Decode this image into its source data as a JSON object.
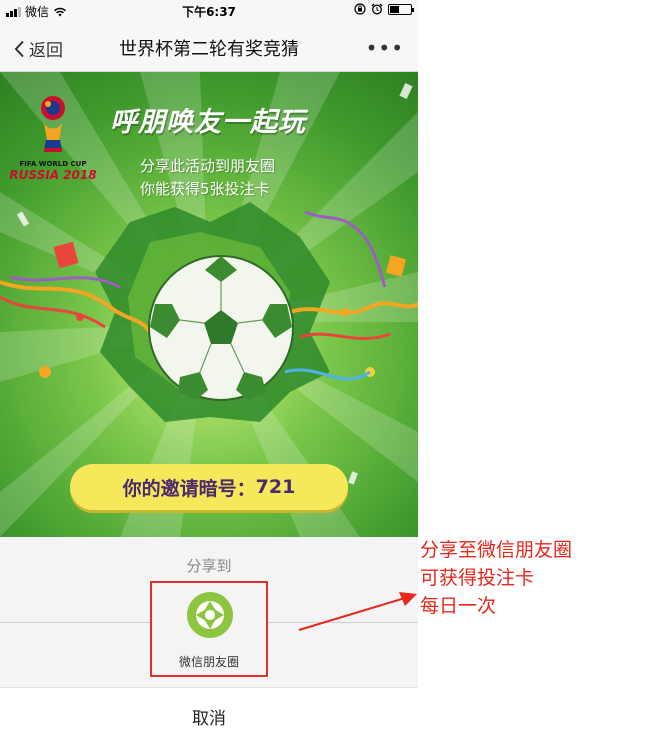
{
  "status_bar": {
    "carrier": "微信",
    "time": "下午6:37",
    "battery_level": 0.45
  },
  "nav": {
    "back_label": "返回",
    "title": "世界杯第二轮有奖竞猜",
    "more_label": "•••"
  },
  "banner": {
    "logo_lines": [
      "FIFA WORLD CUP"
    ],
    "logo_brand": "RUSSIA 2018",
    "headline": "呼朋唤友一起玩",
    "sublines": [
      "分享此活动到朋友圈",
      "你能获得5张投注卡"
    ],
    "invite_label": "你的邀请暗号：",
    "invite_code": "721"
  },
  "share_sheet": {
    "share_to_label": "分享到",
    "moments_label": "微信朋友圈",
    "cancel_label": "取消"
  },
  "annotation": {
    "lines": [
      "分享至微信朋友圈",
      "可获得投注卡",
      "每日一次"
    ],
    "color": "#e8261b"
  },
  "colors": {
    "accent_green": "#8cc63f",
    "highlight_red": "#e0302f",
    "pill_yellow": "#f5e85a",
    "invite_text": "#4a2a6e"
  }
}
